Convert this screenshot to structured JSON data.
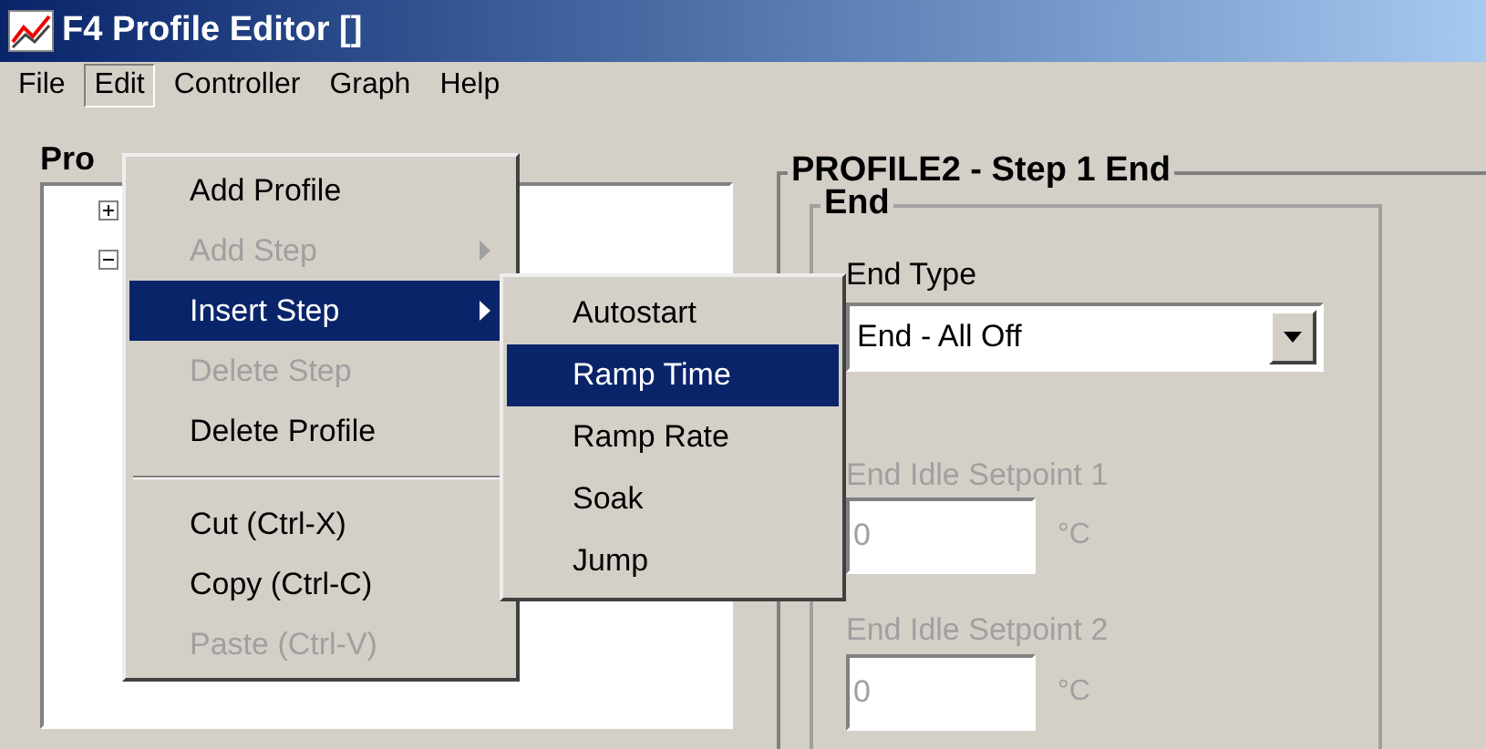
{
  "window": {
    "title": "F4 Profile Editor []"
  },
  "menu_bar": [
    {
      "label": "File",
      "selected": false
    },
    {
      "label": "Edit",
      "selected": true
    },
    {
      "label": "Controller",
      "selected": false
    },
    {
      "label": "Graph",
      "selected": false
    },
    {
      "label": "Help",
      "selected": false
    }
  ],
  "left_panel": {
    "title": "Pro",
    "tree": [
      {
        "expanded": false
      },
      {
        "expanded": true
      }
    ]
  },
  "edit_menu": [
    {
      "kind": "item",
      "label": "Add Profile",
      "disabled": false,
      "selected": false,
      "submenu": false
    },
    {
      "kind": "item",
      "label": "Add Step",
      "disabled": true,
      "selected": false,
      "submenu": true
    },
    {
      "kind": "item",
      "label": "Insert Step",
      "disabled": false,
      "selected": true,
      "submenu": true
    },
    {
      "kind": "item",
      "label": "Delete Step",
      "disabled": true,
      "selected": false,
      "submenu": false
    },
    {
      "kind": "item",
      "label": "Delete Profile",
      "disabled": false,
      "selected": false,
      "submenu": false
    },
    {
      "kind": "separator"
    },
    {
      "kind": "item",
      "label": "Cut (Ctrl-X)",
      "disabled": false,
      "selected": false,
      "submenu": false
    },
    {
      "kind": "item",
      "label": "Copy (Ctrl-C)",
      "disabled": false,
      "selected": false,
      "submenu": false
    },
    {
      "kind": "item",
      "label": "Paste (Ctrl-V)",
      "disabled": true,
      "selected": false,
      "submenu": false
    }
  ],
  "insert_step_menu": [
    {
      "label": "Autostart",
      "selected": false
    },
    {
      "label": "Ramp Time",
      "selected": true
    },
    {
      "label": "Ramp Rate",
      "selected": false
    },
    {
      "label": "Soak",
      "selected": false
    },
    {
      "label": "Jump",
      "selected": false
    }
  ],
  "step_group": {
    "title": "PROFILE2 - Step 1 End",
    "end_group": {
      "title": "End",
      "end_type": {
        "label": "End Type",
        "value": "End - All Off"
      },
      "fields": [
        {
          "label": "End Idle Setpoint 1",
          "value": "0",
          "unit": "°C",
          "disabled": true
        },
        {
          "label": "End Idle Setpoint 2",
          "value": "0",
          "unit": "°C",
          "disabled": true
        }
      ]
    }
  }
}
